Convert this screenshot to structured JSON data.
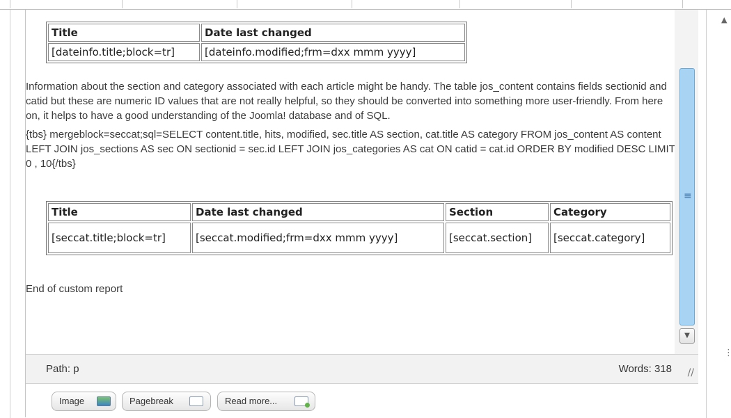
{
  "table1": {
    "headers": [
      "Title",
      "Date last changed"
    ],
    "cells": [
      "[dateinfo.title;block=tr]",
      "[dateinfo.modified;frm=dxx mmm yyyy]"
    ]
  },
  "paragraph1": "Information about the section and category associated with each article might be handy. The table jos_content contains fields sectionid and catid but these are numeric ID values that are not really helpful, so they should be converted into something more user-friendly. From here on, it helps to have a good understanding of the Joomla! database and of SQL.",
  "paragraph2": "{tbs} mergeblock=seccat;sql=SELECT content.title, hits, modified, sec.title AS section, cat.title AS category FROM jos_content AS content LEFT JOIN jos_sections AS sec ON sectionid = sec.id LEFT JOIN jos_categories AS cat ON catid = cat.id ORDER BY modified DESC LIMIT 0 , 10{/tbs}",
  "table2": {
    "headers": [
      "Title",
      "Date last changed",
      "Section",
      "Category"
    ],
    "cells": [
      "[seccat.title;block=tr]",
      "[seccat.modified;frm=dxx mmm yyyy]",
      "[seccat.section]",
      "[seccat.category]"
    ]
  },
  "end_text": "End of custom report",
  "status": {
    "path": "Path: p",
    "words": "Words: 318"
  },
  "buttons": {
    "image": "Image",
    "pagebreak": "Pagebreak",
    "readmore": "Read more..."
  },
  "icons": {
    "scroll_grip": "≡",
    "scroll_down": "▼",
    "resize": "//",
    "far_right": "⋮",
    "scroll_up_caret": "▲"
  },
  "colors": {
    "scroll_thumb": "#a9d3f3",
    "status_bar": "#f2f2f2"
  }
}
